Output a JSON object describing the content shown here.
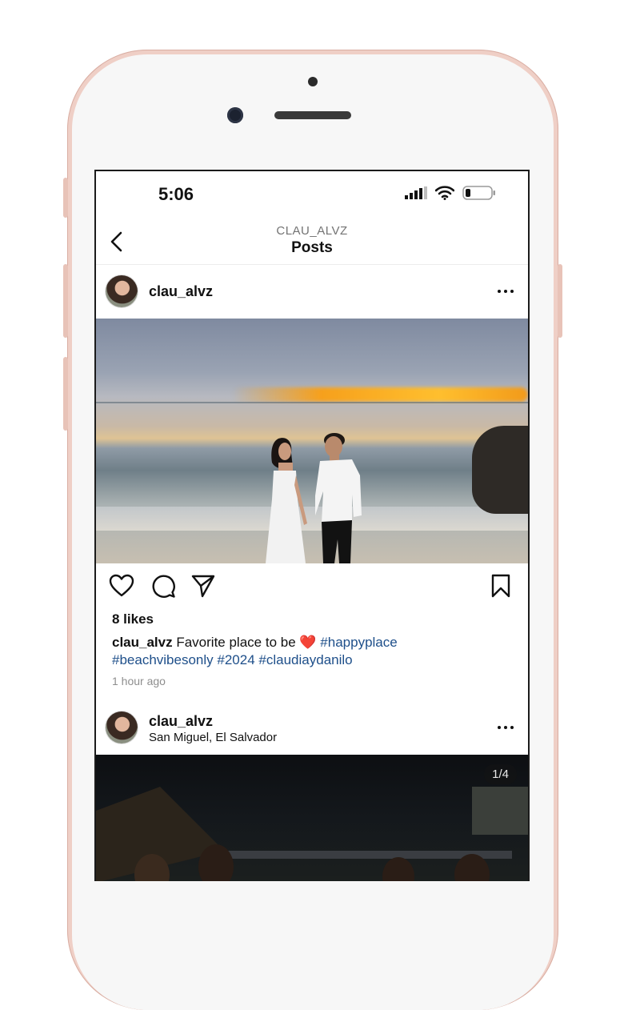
{
  "status_bar": {
    "time": "5:06"
  },
  "header": {
    "account": "CLAU_ALVZ",
    "title": "Posts"
  },
  "posts": [
    {
      "username": "clau_alvz",
      "likes": "8 likes",
      "caption_user": "clau_alvz",
      "caption_text": "Favorite place to be",
      "caption_emoji": "❤️",
      "hashtags": [
        "#happyplace",
        "#beachvibesonly",
        "#2024",
        "#claudiaydanilo"
      ],
      "time_ago": "1 hour ago"
    },
    {
      "username": "clau_alvz",
      "location": "San Miguel, El Salvador",
      "image_counter": "1/4"
    }
  ],
  "icons": {
    "back": "chevron-left-icon",
    "more": "more-horizontal-icon",
    "like": "heart-icon",
    "comment": "comment-icon",
    "share": "paper-plane-icon",
    "save": "bookmark-icon"
  },
  "colors": {
    "hashtag": "#1e4f8a",
    "phone_frame": "#efcfc6",
    "secondary_text": "#8e8e8e"
  }
}
